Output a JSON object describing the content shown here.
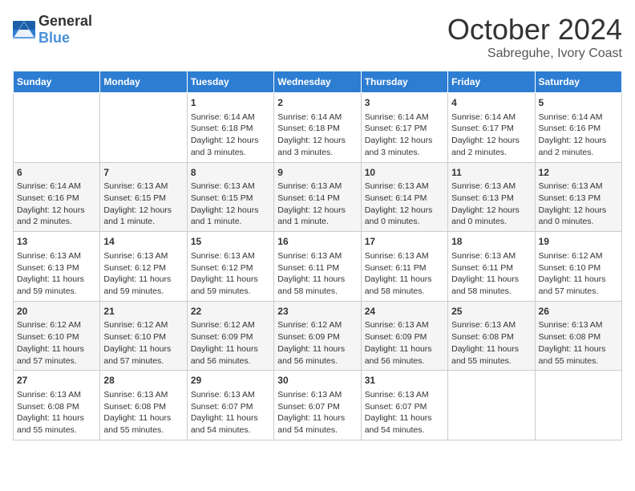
{
  "logo": {
    "general": "General",
    "blue": "Blue"
  },
  "title": "October 2024",
  "location": "Sabreguhe, Ivory Coast",
  "days_of_week": [
    "Sunday",
    "Monday",
    "Tuesday",
    "Wednesday",
    "Thursday",
    "Friday",
    "Saturday"
  ],
  "weeks": [
    [
      {
        "day": "",
        "content": ""
      },
      {
        "day": "",
        "content": ""
      },
      {
        "day": "1",
        "content": "Sunrise: 6:14 AM\nSunset: 6:18 PM\nDaylight: 12 hours and 3 minutes."
      },
      {
        "day": "2",
        "content": "Sunrise: 6:14 AM\nSunset: 6:18 PM\nDaylight: 12 hours and 3 minutes."
      },
      {
        "day": "3",
        "content": "Sunrise: 6:14 AM\nSunset: 6:17 PM\nDaylight: 12 hours and 3 minutes."
      },
      {
        "day": "4",
        "content": "Sunrise: 6:14 AM\nSunset: 6:17 PM\nDaylight: 12 hours and 2 minutes."
      },
      {
        "day": "5",
        "content": "Sunrise: 6:14 AM\nSunset: 6:16 PM\nDaylight: 12 hours and 2 minutes."
      }
    ],
    [
      {
        "day": "6",
        "content": "Sunrise: 6:14 AM\nSunset: 6:16 PM\nDaylight: 12 hours and 2 minutes."
      },
      {
        "day": "7",
        "content": "Sunrise: 6:13 AM\nSunset: 6:15 PM\nDaylight: 12 hours and 1 minute."
      },
      {
        "day": "8",
        "content": "Sunrise: 6:13 AM\nSunset: 6:15 PM\nDaylight: 12 hours and 1 minute."
      },
      {
        "day": "9",
        "content": "Sunrise: 6:13 AM\nSunset: 6:14 PM\nDaylight: 12 hours and 1 minute."
      },
      {
        "day": "10",
        "content": "Sunrise: 6:13 AM\nSunset: 6:14 PM\nDaylight: 12 hours and 0 minutes."
      },
      {
        "day": "11",
        "content": "Sunrise: 6:13 AM\nSunset: 6:13 PM\nDaylight: 12 hours and 0 minutes."
      },
      {
        "day": "12",
        "content": "Sunrise: 6:13 AM\nSunset: 6:13 PM\nDaylight: 12 hours and 0 minutes."
      }
    ],
    [
      {
        "day": "13",
        "content": "Sunrise: 6:13 AM\nSunset: 6:13 PM\nDaylight: 11 hours and 59 minutes."
      },
      {
        "day": "14",
        "content": "Sunrise: 6:13 AM\nSunset: 6:12 PM\nDaylight: 11 hours and 59 minutes."
      },
      {
        "day": "15",
        "content": "Sunrise: 6:13 AM\nSunset: 6:12 PM\nDaylight: 11 hours and 59 minutes."
      },
      {
        "day": "16",
        "content": "Sunrise: 6:13 AM\nSunset: 6:11 PM\nDaylight: 11 hours and 58 minutes."
      },
      {
        "day": "17",
        "content": "Sunrise: 6:13 AM\nSunset: 6:11 PM\nDaylight: 11 hours and 58 minutes."
      },
      {
        "day": "18",
        "content": "Sunrise: 6:13 AM\nSunset: 6:11 PM\nDaylight: 11 hours and 58 minutes."
      },
      {
        "day": "19",
        "content": "Sunrise: 6:12 AM\nSunset: 6:10 PM\nDaylight: 11 hours and 57 minutes."
      }
    ],
    [
      {
        "day": "20",
        "content": "Sunrise: 6:12 AM\nSunset: 6:10 PM\nDaylight: 11 hours and 57 minutes."
      },
      {
        "day": "21",
        "content": "Sunrise: 6:12 AM\nSunset: 6:10 PM\nDaylight: 11 hours and 57 minutes."
      },
      {
        "day": "22",
        "content": "Sunrise: 6:12 AM\nSunset: 6:09 PM\nDaylight: 11 hours and 56 minutes."
      },
      {
        "day": "23",
        "content": "Sunrise: 6:12 AM\nSunset: 6:09 PM\nDaylight: 11 hours and 56 minutes."
      },
      {
        "day": "24",
        "content": "Sunrise: 6:13 AM\nSunset: 6:09 PM\nDaylight: 11 hours and 56 minutes."
      },
      {
        "day": "25",
        "content": "Sunrise: 6:13 AM\nSunset: 6:08 PM\nDaylight: 11 hours and 55 minutes."
      },
      {
        "day": "26",
        "content": "Sunrise: 6:13 AM\nSunset: 6:08 PM\nDaylight: 11 hours and 55 minutes."
      }
    ],
    [
      {
        "day": "27",
        "content": "Sunrise: 6:13 AM\nSunset: 6:08 PM\nDaylight: 11 hours and 55 minutes."
      },
      {
        "day": "28",
        "content": "Sunrise: 6:13 AM\nSunset: 6:08 PM\nDaylight: 11 hours and 55 minutes."
      },
      {
        "day": "29",
        "content": "Sunrise: 6:13 AM\nSunset: 6:07 PM\nDaylight: 11 hours and 54 minutes."
      },
      {
        "day": "30",
        "content": "Sunrise: 6:13 AM\nSunset: 6:07 PM\nDaylight: 11 hours and 54 minutes."
      },
      {
        "day": "31",
        "content": "Sunrise: 6:13 AM\nSunset: 6:07 PM\nDaylight: 11 hours and 54 minutes."
      },
      {
        "day": "",
        "content": ""
      },
      {
        "day": "",
        "content": ""
      }
    ]
  ]
}
